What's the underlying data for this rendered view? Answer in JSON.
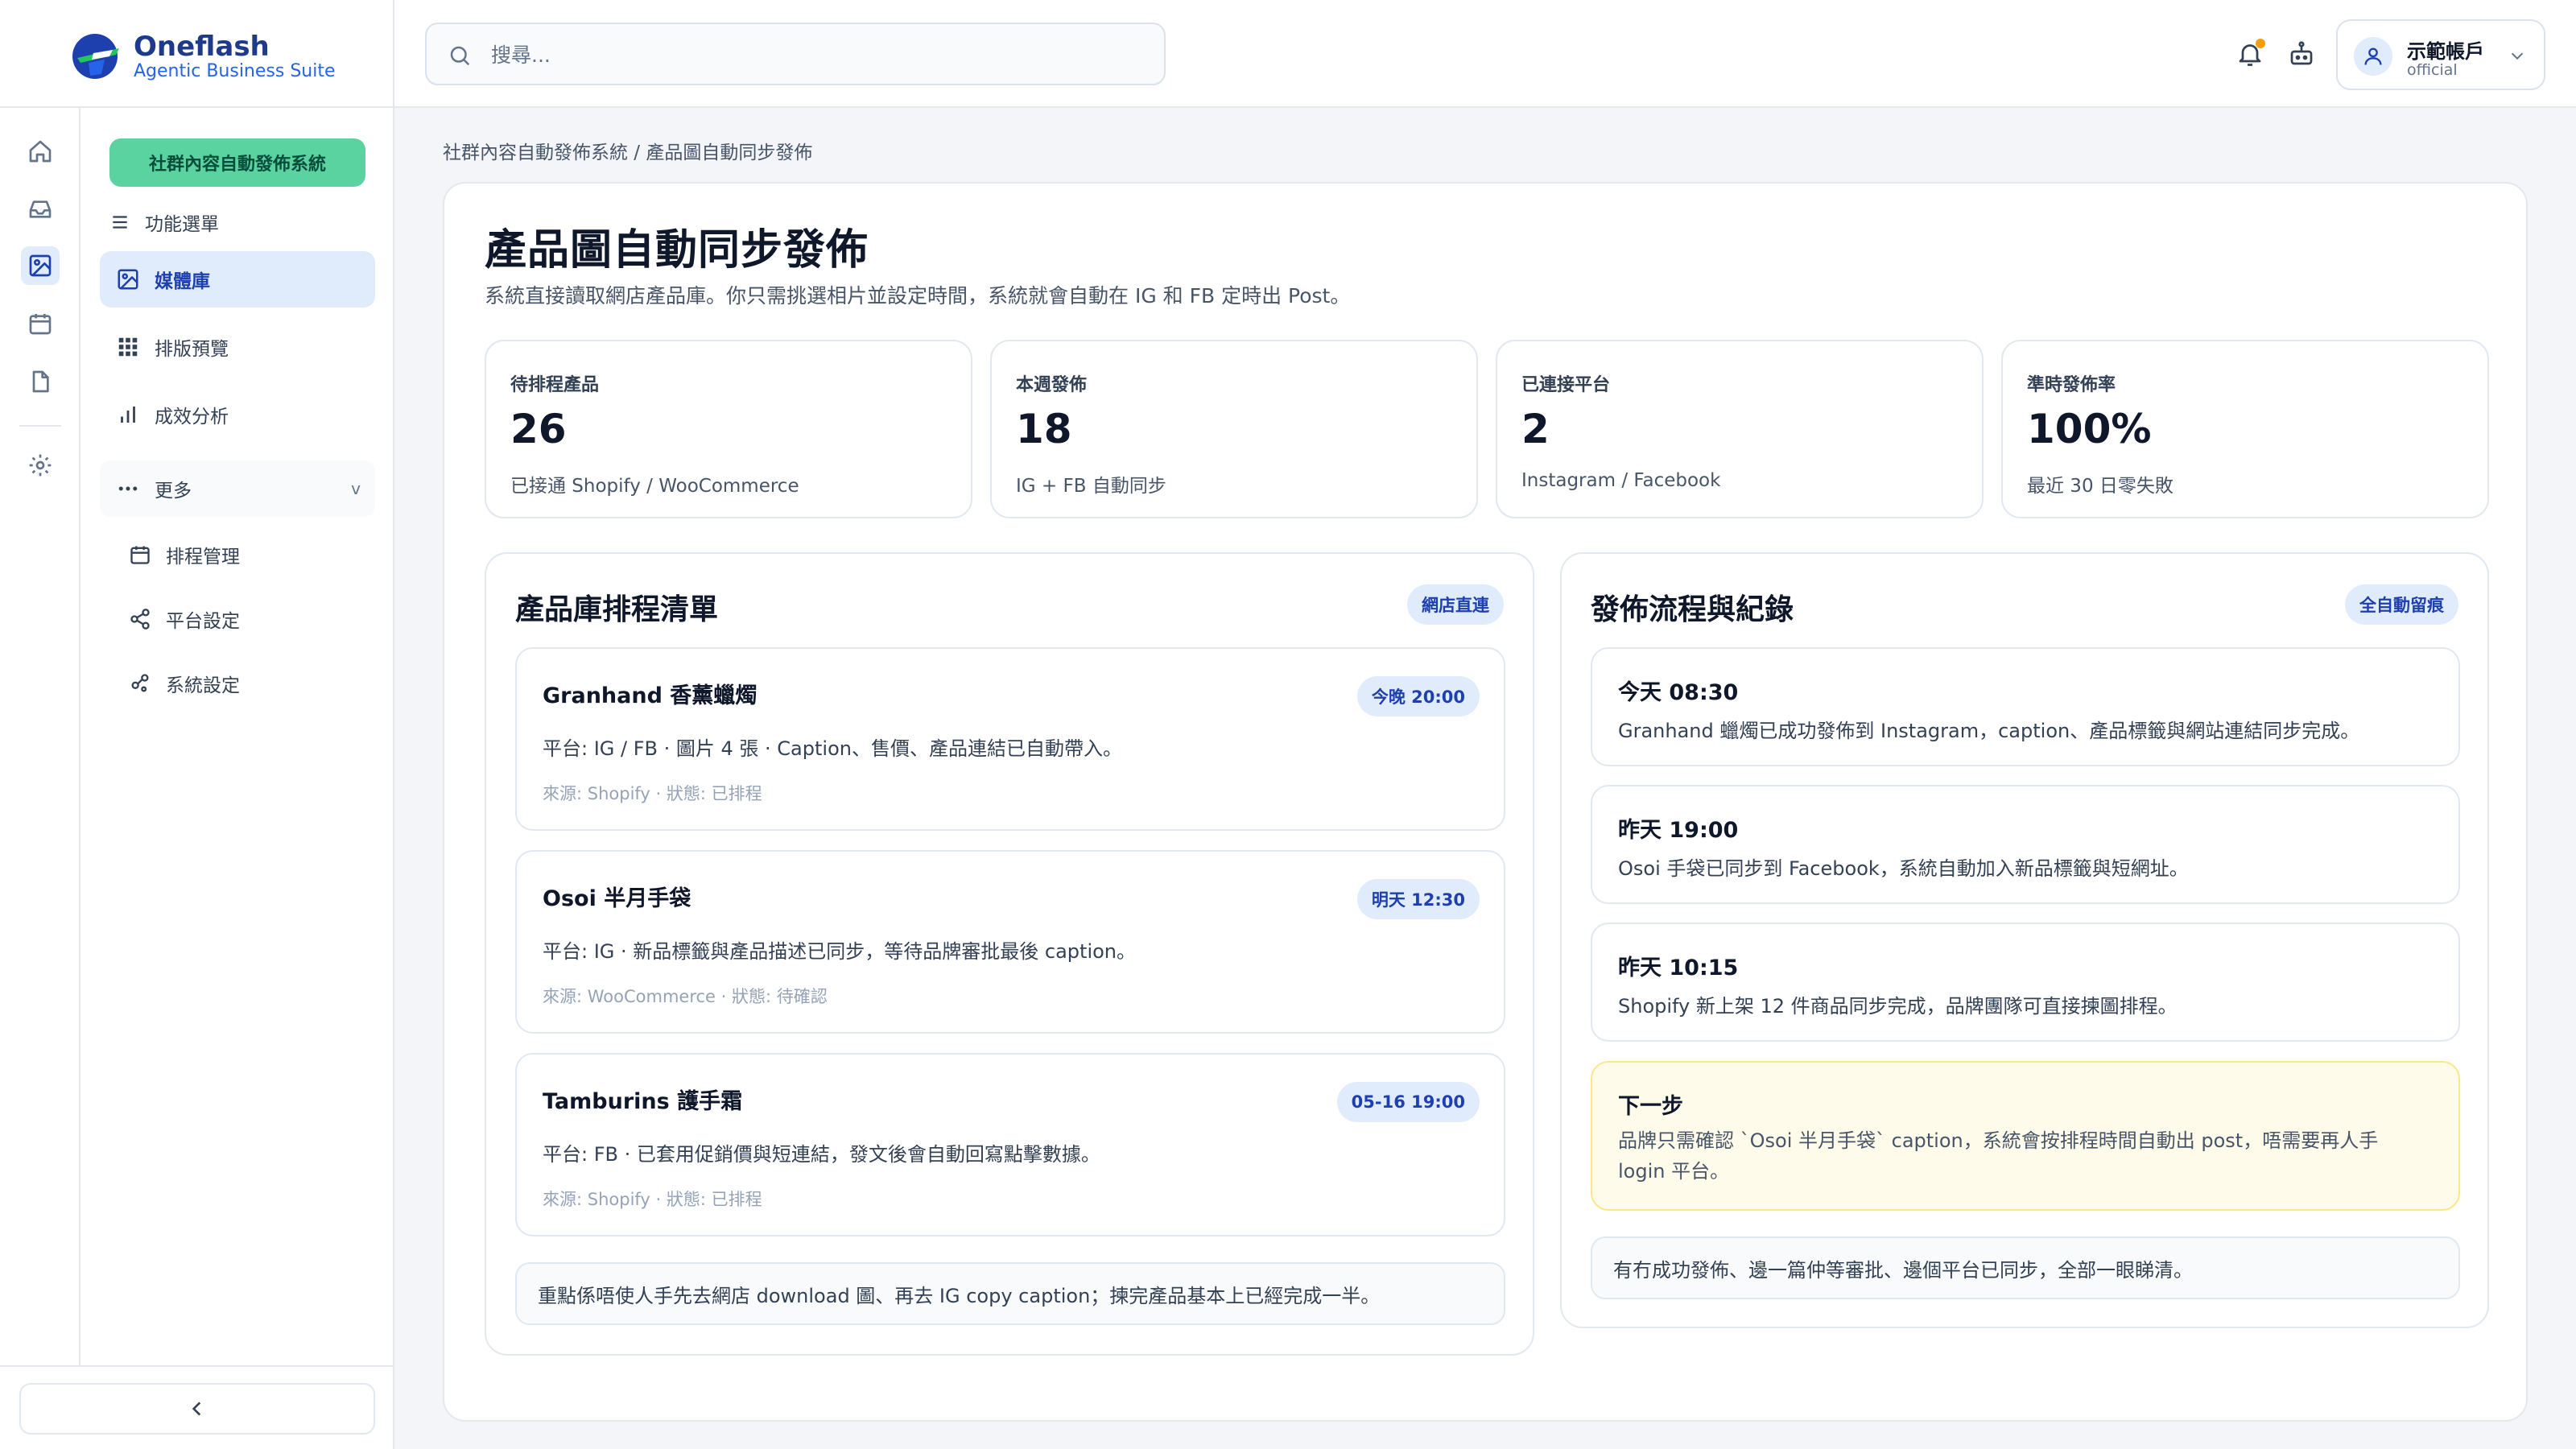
{
  "brand": {
    "name": "Oneflash",
    "tagline": "Agentic Business Suite"
  },
  "search": {
    "placeholder": "搜尋..."
  },
  "account": {
    "name": "示範帳戶",
    "subtitle": "official"
  },
  "sidebar": {
    "system_label": "社群內容自動發佈系統",
    "menu_label": "功能選單",
    "items": [
      {
        "label": "媒體庫",
        "icon": "image-icon",
        "active": true
      },
      {
        "label": "排版預覽",
        "icon": "grid-icon"
      },
      {
        "label": "成效分析",
        "icon": "bar-chart-icon"
      }
    ],
    "more_label": "更多",
    "more_chevron": "v",
    "more_items": [
      {
        "label": "排程管理",
        "icon": "calendar-icon"
      },
      {
        "label": "平台設定",
        "icon": "share-icon"
      },
      {
        "label": "系統設定",
        "icon": "settings-nodes-icon"
      }
    ]
  },
  "breadcrumb": "社群內容自動發佈系統 / 產品圖自動同步發佈",
  "page": {
    "title": "產品圖自動同步發佈",
    "description": "系統直接讀取網店產品庫。你只需挑選相片並設定時間，系統就會自動在 IG 和 FB 定時出 Post。"
  },
  "stats": [
    {
      "label": "待排程產品",
      "value": "26",
      "sub": "已接通 Shopify / WooCommerce"
    },
    {
      "label": "本週發佈",
      "value": "18",
      "sub": "IG + FB 自動同步"
    },
    {
      "label": "已連接平台",
      "value": "2",
      "sub": "Instagram / Facebook"
    },
    {
      "label": "準時發佈率",
      "value": "100%",
      "sub": "最近 30 日零失敗"
    }
  ],
  "schedule": {
    "title": "產品庫排程清單",
    "badge": "網店直連",
    "items": [
      {
        "title": "Granhand 香薰蠟燭",
        "time": "今晚 20:00",
        "desc": "平台: IG / FB · 圖片 4 張 · Caption、售價、產品連結已自動帶入。",
        "source": "來源: Shopify · 狀態: 已排程"
      },
      {
        "title": "Osoi 半月手袋",
        "time": "明天 12:30",
        "desc": "平台: IG · 新品標籤與產品描述已同步，等待品牌審批最後 caption。",
        "source": "來源: WooCommerce · 狀態: 待確認"
      },
      {
        "title": "Tamburins 護手霜",
        "time": "05-16 19:00",
        "desc": "平台: FB · 已套用促銷價與短連結，發文後會自動回寫點擊數據。",
        "source": "來源: Shopify · 狀態: 已排程"
      }
    ],
    "note": "重點係唔使人手先去網店 download 圖、再去 IG copy caption；揀完產品基本上已經完成一半。"
  },
  "flow": {
    "title": "發佈流程與紀錄",
    "badge": "全自動留痕",
    "logs": [
      {
        "title": "今天 08:30",
        "desc": "Granhand 蠟燭已成功發佈到 Instagram，caption、產品標籤與網站連結同步完成。"
      },
      {
        "title": "昨天 19:00",
        "desc": "Osoi 手袋已同步到 Facebook，系統自動加入新品標籤與短網址。"
      },
      {
        "title": "昨天 10:15",
        "desc": "Shopify 新上架 12 件商品同步完成，品牌團隊可直接揀圖排程。"
      }
    ],
    "next": {
      "title": "下一步",
      "desc": "品牌只需確認 `Osoi 半月手袋` caption，系統會按排程時間自動出 post，唔需要再人手 login 平台。"
    },
    "note": "有冇成功發佈、邊一篇仲等審批、邊個平台已同步，全部一眼睇清。"
  },
  "colors": {
    "accent": "#1e40af",
    "accent_bg": "#e0ecfb",
    "green_pill": "#5ad3a1",
    "warning_bg": "#fffbeb",
    "bell_dot": "#f59e0b"
  }
}
